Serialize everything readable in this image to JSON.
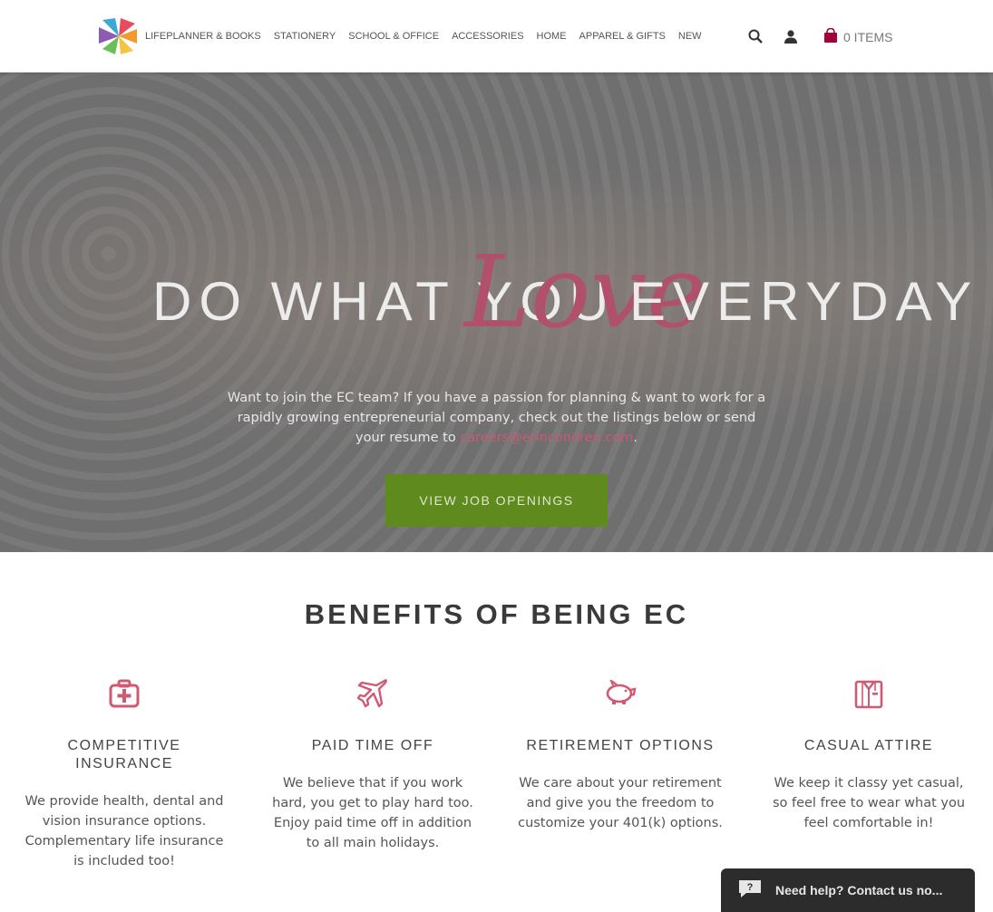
{
  "header": {
    "nav": [
      "LIFEPLANNER & BOOKS",
      "STATIONERY",
      "SCHOOL & OFFICE",
      "ACCESSORIES",
      "HOME",
      "APPAREL & GIFTS",
      "NEW"
    ],
    "cart_label": "0 ITEMS",
    "icons": [
      "logo-icon",
      "search-icon",
      "user-icon",
      "bag-icon"
    ]
  },
  "hero": {
    "title_part1": "DO WHAT YOU",
    "title_love": "Love",
    "title_part2": "EVERYDAY",
    "text_before": "Want to join the EC team? If you have a passion for planning & want to work for a rapidly growing entrepreneurial company, check out the listings below or send your resume to ",
    "email": "careers@erincondren.com",
    "text_after": ".",
    "button_label": "VIEW JOB OPENINGS"
  },
  "benefits": {
    "title": "BENEFITS OF BEING EC",
    "items": [
      {
        "heading": "COMPETITIVE INSURANCE",
        "text": "We provide health, dental and vision insurance options. Complementary life insurance is included too!",
        "icon": "first-aid-kit-icon"
      },
      {
        "heading": "PAID TIME OFF",
        "text": "We believe that if you work hard, you get to play hard too. Enjoy paid time off in addition to all main holidays.",
        "icon": "airplane-icon"
      },
      {
        "heading": "RETIREMENT OPTIONS",
        "text": "We care about your retirement and give you the freedom to customize your 401(k) options.",
        "icon": "piggy-bank-icon"
      },
      {
        "heading": "CASUAL ATTIRE",
        "text": "We keep it classy yet casual, so feel free to wear what you feel comfortable in!",
        "icon": "shirt-icon"
      }
    ]
  },
  "chat": {
    "label": "Need help? Contact us no..."
  },
  "colors": {
    "accent_pink": "#c85a75",
    "button_green": "#5f8a1d",
    "icon_pink": "#d05a72"
  }
}
